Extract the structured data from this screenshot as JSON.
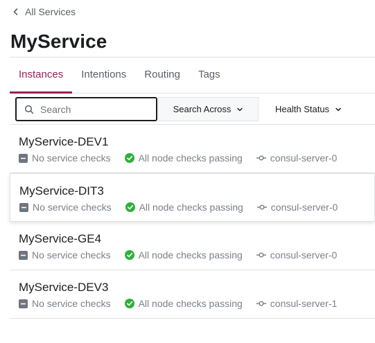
{
  "breadcrumb": {
    "label": "All Services"
  },
  "page": {
    "title": "MyService"
  },
  "tabs": [
    {
      "label": "Instances",
      "active": true
    },
    {
      "label": "Intentions",
      "active": false
    },
    {
      "label": "Routing",
      "active": false
    },
    {
      "label": "Tags",
      "active": false
    }
  ],
  "search": {
    "placeholder": "Search",
    "value": ""
  },
  "filters": {
    "search_across_label": "Search Across",
    "health_status_label": "Health Status"
  },
  "colors": {
    "accent": "#9a1f5a",
    "passing": "#2eb039",
    "muted": "#7b8087"
  },
  "instances": [
    {
      "name": "MyService-DEV1",
      "service_checks": "No service checks",
      "node_checks": "All node checks passing",
      "node": "consul-server-0"
    },
    {
      "name": "MyService-DIT3",
      "service_checks": "No service checks",
      "node_checks": "All node checks passing",
      "node": "consul-server-0"
    },
    {
      "name": "MyService-GE4",
      "service_checks": "No service checks",
      "node_checks": "All node checks passing",
      "node": "consul-server-0"
    },
    {
      "name": "MyService-DEV3",
      "service_checks": "No service checks",
      "node_checks": "All node checks passing",
      "node": "consul-server-1"
    }
  ]
}
